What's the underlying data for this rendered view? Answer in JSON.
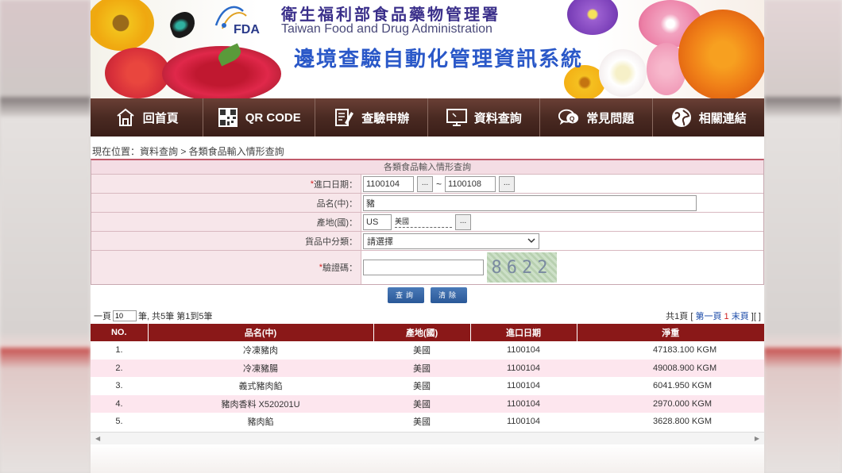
{
  "banner": {
    "agency_cn": "衛生福利部食品藥物管理署",
    "agency_en": "Taiwan Food and Drug Administration",
    "logo_text": "FDA",
    "system_title": "邊境查驗自動化管理資訊系統"
  },
  "nav": {
    "items": [
      {
        "label": "回首頁",
        "icon": "home-icon"
      },
      {
        "label": "QR CODE",
        "icon": "qrcode-icon"
      },
      {
        "label": "查驗申辦",
        "icon": "form-edit-icon"
      },
      {
        "label": "資料查詢",
        "icon": "monitor-icon"
      },
      {
        "label": "常見問題",
        "icon": "faq-icon"
      },
      {
        "label": "相關連結",
        "icon": "globe-icon"
      }
    ]
  },
  "breadcrumb": "現在位置：資料查詢 > 各類食品輸入情形查詢",
  "form": {
    "title": "各類食品輸入情形查詢",
    "import_date_label": "進口日期：",
    "import_date_from": "1100104",
    "import_date_to": "1100108",
    "date_sep": "~",
    "picker_label": "...",
    "product_name_label": "品名(中)：",
    "product_name_value": "豬",
    "origin_label": "產地(國)：",
    "origin_code": "US",
    "origin_name": "美國",
    "category_label": "貨品中分類：",
    "category_selected": "請選擇",
    "captcha_label": "驗證碼：",
    "captcha_value": "",
    "captcha_text": "8622",
    "required_mark": "*"
  },
  "actions": {
    "search_label": "查詢",
    "clear_label": "清除"
  },
  "paging": {
    "per_page_prefix": "一頁",
    "per_page_value": "10",
    "summary": "筆, 共5筆 第1到5筆",
    "total_pages": "共1頁 [",
    "first": "第一頁",
    "current": "1",
    "last": "末頁",
    "tail": "][ ]"
  },
  "table": {
    "headers": [
      "NO.",
      "品名(中)",
      "產地(國)",
      "進口日期",
      "淨重"
    ],
    "rows": [
      [
        "1.",
        "冷凍豬肉",
        "美國",
        "1100104",
        "47183.100 KGM"
      ],
      [
        "2.",
        "冷凍豬腸",
        "美國",
        "1100104",
        "49008.900 KGM"
      ],
      [
        "3.",
        "義式豬肉餡",
        "美國",
        "1100104",
        "6041.950 KGM"
      ],
      [
        "4.",
        "豬肉香料 X520201U",
        "美國",
        "1100104",
        "2970.000 KGM"
      ],
      [
        "5.",
        "豬肉餡",
        "美國",
        "1100104",
        "3628.800 KGM"
      ]
    ]
  },
  "colors": {
    "nav_bg": "#4a2a22",
    "table_header": "#8a1818",
    "form_label_bg": "#f7e6ea",
    "row_alt": "#fde6ee",
    "button_blue": "#2a5898"
  }
}
